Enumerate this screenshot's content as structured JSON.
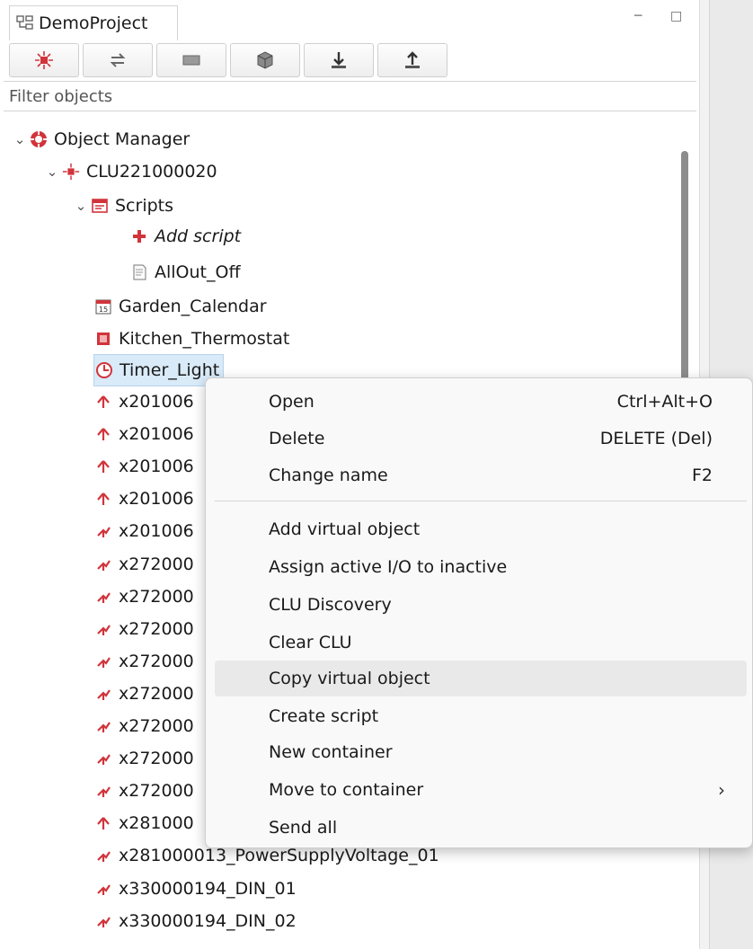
{
  "tab": {
    "title": "DemoProject"
  },
  "filter": {
    "placeholder": "Filter objects"
  },
  "tree": {
    "root": "Object Manager",
    "clu": "CLU221000020",
    "scripts": "Scripts",
    "add_script": "Add script",
    "script_1": "AllOut_Off",
    "calendar": "Garden_Calendar",
    "thermostat": "Kitchen_Thermostat",
    "timer": "Timer_Light",
    "items": [
      "x201006",
      "x201006",
      "x201006",
      "x201006",
      "x201006",
      "x272000",
      "x272000",
      "x272000",
      "x272000",
      "x272000",
      "x272000",
      "x272000",
      "x272000",
      "x281000",
      "x281000013_PowerSupplyVoltage_01",
      "x330000194_DIN_01",
      "x330000194_DIN_02"
    ]
  },
  "menu": {
    "open": {
      "label": "Open",
      "shortcut": "Ctrl+Alt+O"
    },
    "delete": {
      "label": "Delete",
      "shortcut": "DELETE (Del)"
    },
    "rename": {
      "label": "Change name",
      "shortcut": "F2"
    },
    "add_virtual": "Add virtual object",
    "assign_io": "Assign active I/O to inactive",
    "discovery": "CLU Discovery",
    "clear": "Clear CLU",
    "copy_virtual": "Copy virtual object",
    "create_script": "Create script",
    "new_container": "New container",
    "move_container": "Move to container",
    "send_all": "Send all"
  },
  "colors": {
    "accent_red": "#d1343b",
    "selection": "#d9eaf8"
  }
}
